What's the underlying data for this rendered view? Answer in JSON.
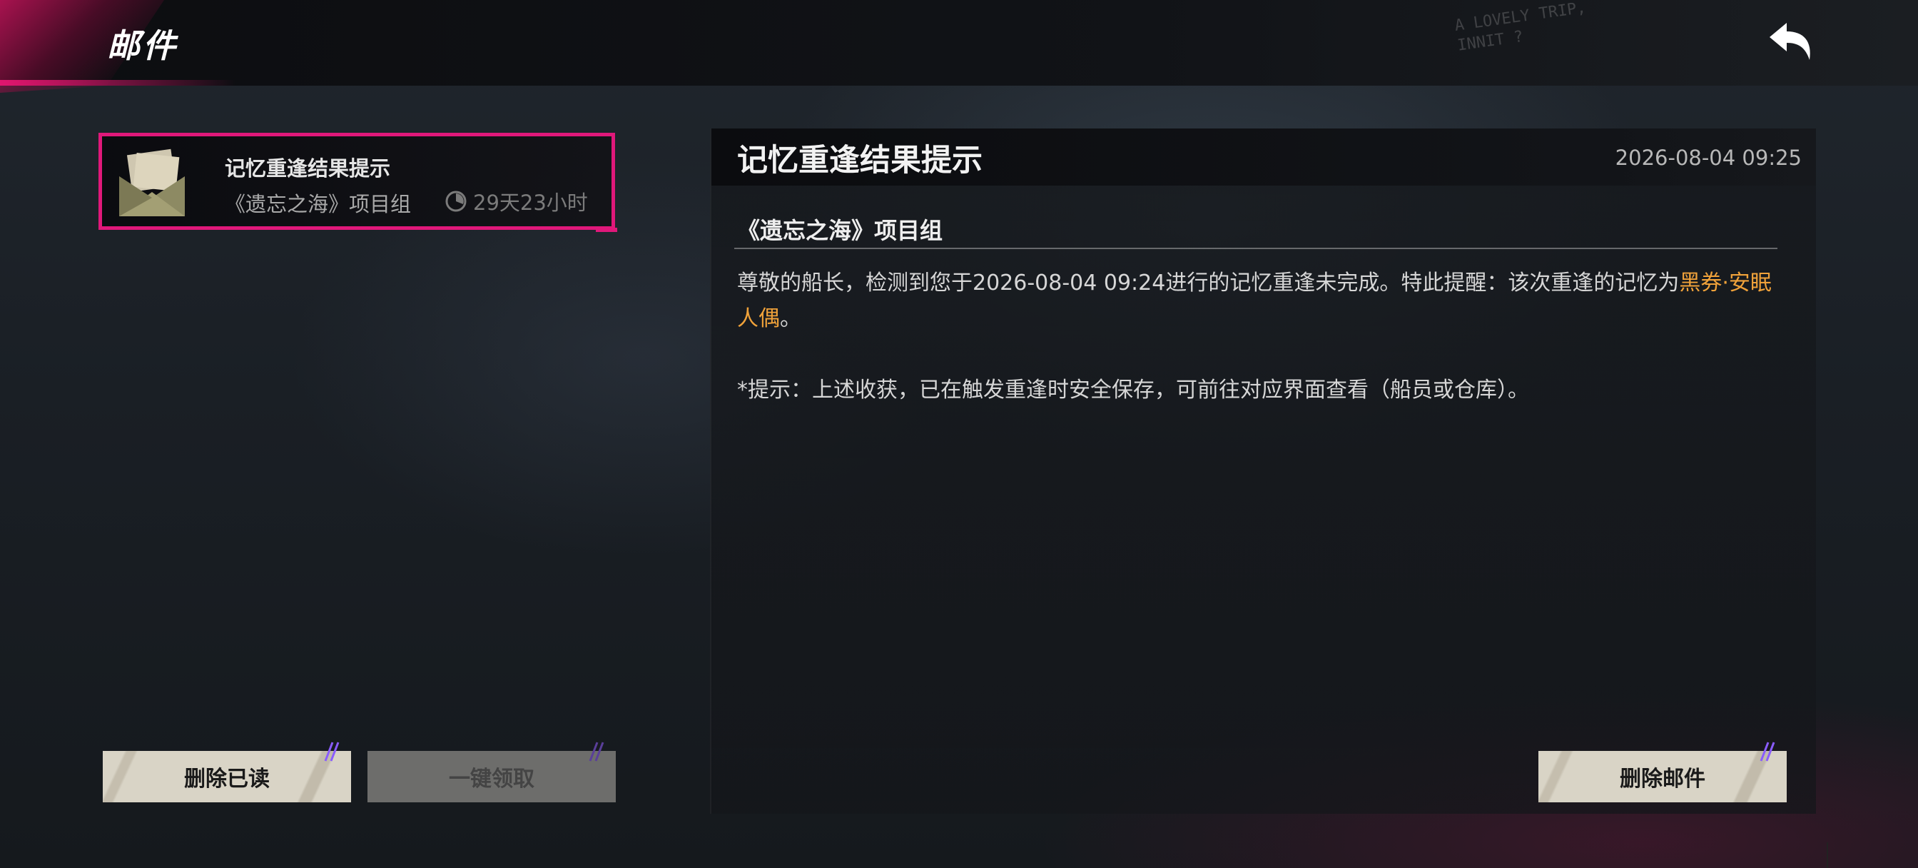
{
  "header": {
    "title": "邮件",
    "decor_text": "A LOVELY TRIP,\nINNIT ?",
    "back_icon": "return-arrow-icon"
  },
  "mail_list": [
    {
      "title": "记忆重逢结果提示",
      "sender": "《遗忘之海》项目组",
      "expire": "29天23小时",
      "selected": true,
      "icon": "envelope-icon"
    }
  ],
  "buttons": {
    "delete_read": "删除已读",
    "claim_all": "一键领取",
    "delete_mail": "删除邮件"
  },
  "detail": {
    "title": "记忆重逢结果提示",
    "time": "2026-08-04 09:25",
    "sender": "《遗忘之海》项目组",
    "body_prefix": "尊敬的船长，检测到您于2026-08-04 09:24进行的记忆重逢未完成。特此提醒：该次重逢的记忆为",
    "body_highlight": "黑券·安眠人偶",
    "body_suffix": "。",
    "note": "*提示：上述收获，已在触发重逢时安全保存，可前往对应界面查看（船员或仓库）。"
  },
  "colors": {
    "accent": "#e0187a",
    "highlight": "#f0a23a",
    "button_bg": "#d9d4c6"
  }
}
